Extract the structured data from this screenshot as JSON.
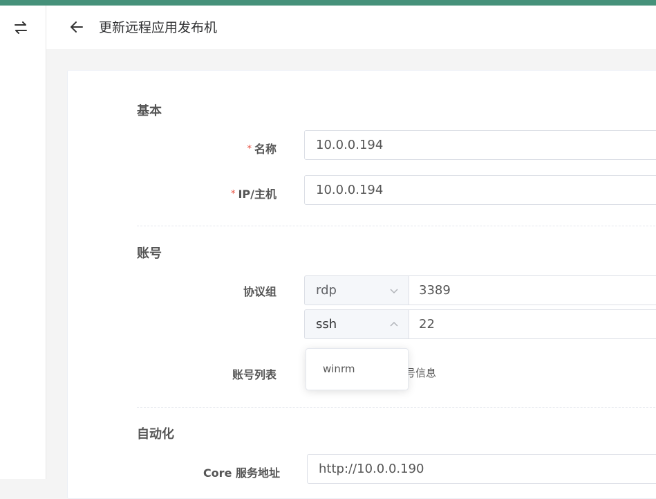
{
  "header": {
    "title": "更新远程应用发布机"
  },
  "sections": {
    "basic": {
      "title": "基本"
    },
    "account": {
      "title": "账号"
    },
    "automation": {
      "title": "自动化"
    }
  },
  "form": {
    "name": {
      "label": "名称",
      "required": "*",
      "value": "10.0.0.194"
    },
    "host": {
      "label": "IP/主机",
      "required": "*",
      "value": "10.0.0.194"
    },
    "protocols": {
      "label": "协议组",
      "rows": [
        {
          "protocol": "rdp",
          "port": "3389"
        },
        {
          "protocol": "ssh",
          "port": "22"
        }
      ]
    },
    "account_list": {
      "label": "账号列表",
      "hint_tail": "号信息"
    },
    "core_url": {
      "label": "Core 服务地址",
      "value": "http://10.0.0.190"
    }
  },
  "dropdown": {
    "options": [
      "winrm"
    ]
  },
  "colors": {
    "topbar": "#46917a",
    "required": "#e74c3c"
  }
}
